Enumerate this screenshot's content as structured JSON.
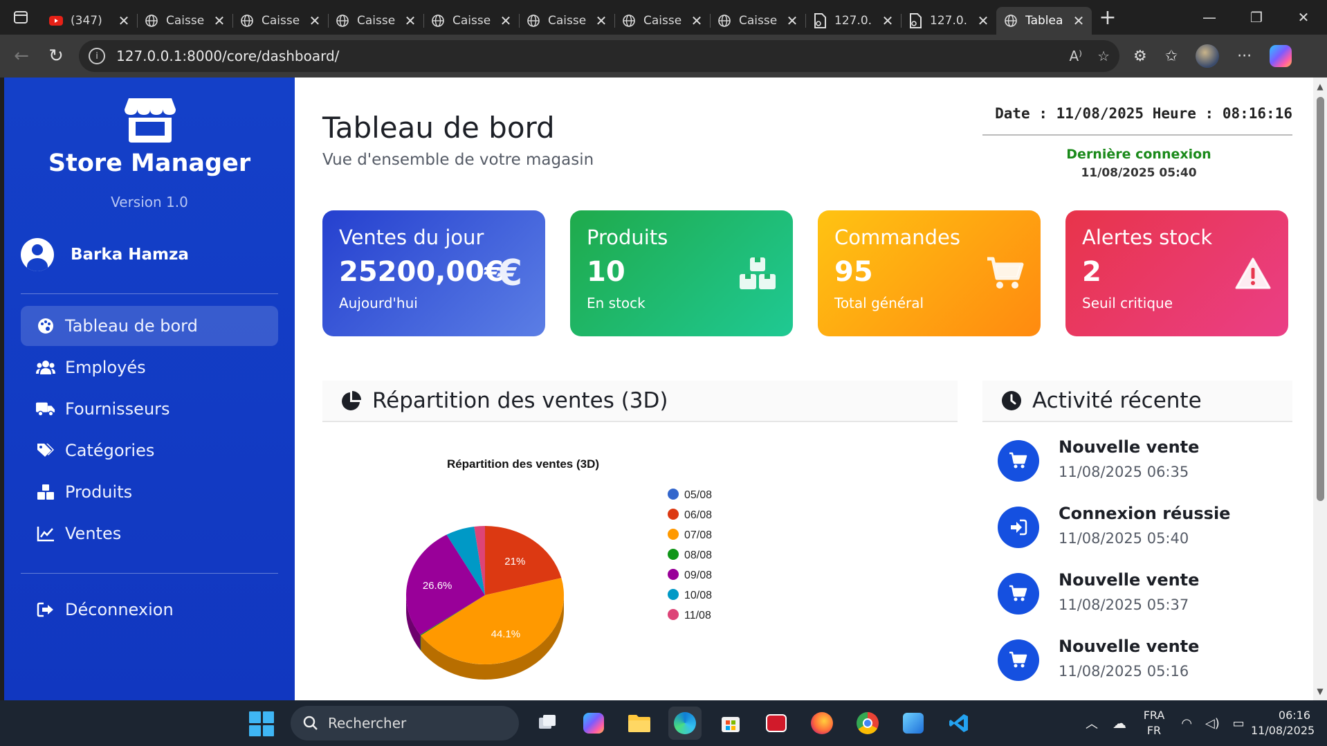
{
  "browser": {
    "tabs": [
      {
        "title": "(347)",
        "icon": "youtube-icon",
        "active": false
      },
      {
        "title": "Caisse",
        "icon": "globe-icon",
        "active": false
      },
      {
        "title": "Caisse",
        "icon": "globe-icon",
        "active": false
      },
      {
        "title": "Caisse",
        "icon": "globe-icon",
        "active": false
      },
      {
        "title": "Caisse",
        "icon": "globe-icon",
        "active": false
      },
      {
        "title": "Caisse",
        "icon": "globe-icon",
        "active": false
      },
      {
        "title": "Caisse",
        "icon": "globe-icon",
        "active": false
      },
      {
        "title": "Caisse",
        "icon": "globe-icon",
        "active": false
      },
      {
        "title": "127.0.",
        "icon": "file-icon",
        "active": false
      },
      {
        "title": "127.0.",
        "icon": "file-icon",
        "active": false
      },
      {
        "title": "Tablea",
        "icon": "globe-icon",
        "active": true
      }
    ],
    "url": "127.0.0.1:8000/core/dashboard/"
  },
  "sidebar": {
    "brand": "Store Manager",
    "version": "Version 1.0",
    "user": "Barka Hamza",
    "items": [
      {
        "label": "Tableau de bord",
        "icon": "palette-icon",
        "active": true
      },
      {
        "label": "Employés",
        "icon": "users-icon",
        "active": false
      },
      {
        "label": "Fournisseurs",
        "icon": "truck-icon",
        "active": false
      },
      {
        "label": "Catégories",
        "icon": "tags-icon",
        "active": false
      },
      {
        "label": "Produits",
        "icon": "boxes-icon",
        "active": false
      },
      {
        "label": "Ventes",
        "icon": "chart-line-icon",
        "active": false
      }
    ],
    "logout": "Déconnexion"
  },
  "header": {
    "title": "Tableau de bord",
    "subtitle": "Vue d'ensemble de votre magasin",
    "datetime": "Date : 11/08/2025 Heure : 08:16:16",
    "last_login_label": "Dernière connexion",
    "last_login_value": "11/08/2025 05:40"
  },
  "cards": [
    {
      "title": "Ventes du jour",
      "value": "25200,00€",
      "sub": "Aujourd'hui",
      "icon": "euro-icon"
    },
    {
      "title": "Produits",
      "value": "10",
      "sub": "En stock",
      "icon": "boxes-icon"
    },
    {
      "title": "Commandes",
      "value": "95",
      "sub": "Total général",
      "icon": "cart-icon"
    },
    {
      "title": "Alertes stock",
      "value": "2",
      "sub": "Seuil critique",
      "icon": "warning-icon"
    }
  ],
  "chart_panel": {
    "heading": "Répartition des ventes (3D)"
  },
  "chart_data": {
    "type": "pie",
    "title": "Répartition des ventes (3D)",
    "categories": [
      "05/08",
      "06/08",
      "07/08",
      "08/08",
      "09/08",
      "10/08",
      "11/08"
    ],
    "values": [
      0,
      21.0,
      44.1,
      0.2,
      26.6,
      5.9,
      2.2
    ],
    "labels_shown": [
      "",
      "21%",
      "44.1%",
      "",
      "26.6%",
      "",
      ""
    ],
    "colors": [
      "#3366cc",
      "#dc3912",
      "#ff9900",
      "#109618",
      "#990099",
      "#0099c6",
      "#dd4477"
    ],
    "legend": "right"
  },
  "activity": {
    "heading": "Activité récente",
    "items": [
      {
        "title": "Nouvelle vente",
        "time": "11/08/2025 06:35",
        "icon": "cart-icon"
      },
      {
        "title": "Connexion réussie",
        "time": "11/08/2025 05:40",
        "icon": "sign-in-icon"
      },
      {
        "title": "Nouvelle vente",
        "time": "11/08/2025 05:37",
        "icon": "cart-icon"
      },
      {
        "title": "Nouvelle vente",
        "time": "11/08/2025 05:16",
        "icon": "cart-icon"
      }
    ]
  },
  "taskbar": {
    "search_placeholder": "Rechercher",
    "lang_top": "FRA",
    "lang_bottom": "FR",
    "time": "06:16",
    "date": "11/08/2025"
  },
  "colors": {
    "sidebar": "#1440c8",
    "accent": "#1550e0",
    "card_blue": "#2540cf",
    "card_green": "#1faa4b",
    "card_orange": "#ff8a10",
    "card_red": "#e8344a"
  }
}
